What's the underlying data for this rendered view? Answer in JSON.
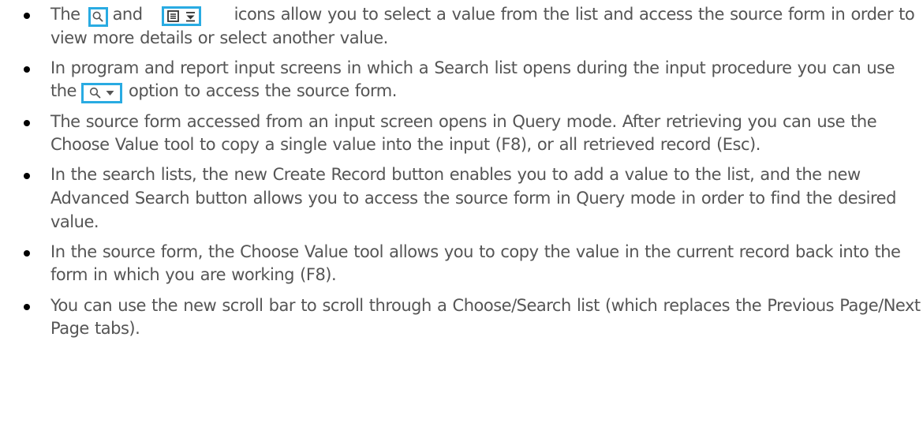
{
  "bullets": [
    {
      "pre": "The",
      "mid": "and",
      "post": "icons allow you to select a value from the list and access the source form in order to view more details or select another value."
    },
    {
      "pre": "In program and report input screens in which a Search list opens during the input procedure you can use the",
      "post": "option to access the source form."
    },
    {
      "text": "The source form accessed from an input screen opens in Query mode. After retrieving you can use the Choose Value tool to copy a single value into the input (F8), or all retrieved record (Esc)."
    },
    {
      "text": "In the search lists, the new Create Record button enables you to add a value to the list, and the new Advanced Search button allows you to access the source form in Query mode in order to find the desired value."
    },
    {
      "text": "In the source form, the Choose Value tool allows you to copy the value in the current record back into the form in which you are working (F8)."
    },
    {
      "text": "You can use the new scroll bar to scroll through a Choose/Search list (which replaces the Previous Page/Next Page tabs)."
    }
  ],
  "icons": {
    "search": "magnifier-icon",
    "list": "list-document-icon",
    "expand": "collapse-down-arrow-icon",
    "dropdown": "dropdown-triangle-icon"
  },
  "colors": {
    "icon_border": "#29abe2",
    "text": "#555555",
    "bullet": "#000000"
  }
}
